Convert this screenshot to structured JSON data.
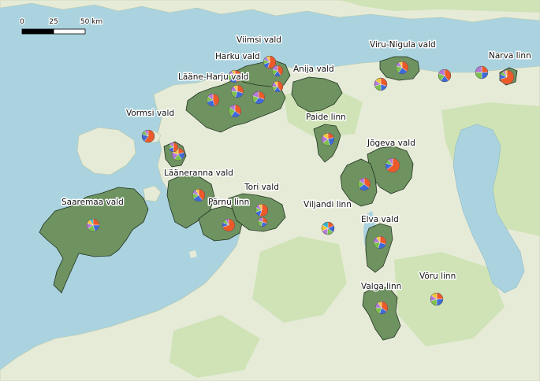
{
  "scale_bar": {
    "labels": [
      "0",
      "25",
      "50 km"
    ]
  },
  "colors": {
    "sea": "#aad3df",
    "land": "#e6ebd8",
    "forest": "#cfe3b6",
    "lake": "#aad3df",
    "region_fill": "#6e9260",
    "region_stroke": "#223322",
    "pie_palette": [
      "#ec5a2a",
      "#3f6ad8",
      "#7cc24a",
      "#b27ad6",
      "#f3c63a",
      "#2fb5c9",
      "#e87fb3",
      "#8a5a3a"
    ]
  },
  "places": [
    {
      "name": "Viimsi vald",
      "pie": [
        55,
        15,
        12,
        10,
        8
      ]
    },
    {
      "name": "Harku vald",
      "pie": [
        45,
        20,
        15,
        12,
        8
      ]
    },
    {
      "name": "Lääne-Harju vald",
      "pie": [
        30,
        25,
        20,
        15,
        10
      ]
    },
    {
      "name": "Anija vald",
      "pie": [
        40,
        20,
        15,
        15,
        10
      ]
    },
    {
      "name": "Viru-Nigula vald",
      "pie": [
        35,
        25,
        20,
        12,
        8
      ]
    },
    {
      "name": "Narva linn",
      "pie": [
        70,
        12,
        8,
        6,
        4
      ]
    },
    {
      "name": "Vormsi vald",
      "pie": [
        60,
        20,
        10,
        10
      ]
    },
    {
      "name": "Paide linn",
      "pie": [
        20,
        25,
        20,
        20,
        15
      ]
    },
    {
      "name": "Jõgeva vald",
      "pie": [
        65,
        15,
        10,
        10
      ]
    },
    {
      "name": "Lääneranna vald",
      "pie": [
        40,
        25,
        15,
        12,
        8
      ]
    },
    {
      "name": "Tori vald",
      "pie": [
        55,
        15,
        12,
        10,
        8
      ]
    },
    {
      "name": "Saaremaa vald",
      "pie": [
        25,
        20,
        20,
        15,
        12,
        8
      ]
    },
    {
      "name": "Pärnu linn",
      "pie": [
        70,
        12,
        10,
        8
      ]
    },
    {
      "name": "Viljandi linn",
      "pie": [
        18,
        18,
        16,
        16,
        16,
        16
      ]
    },
    {
      "name": "Elva vald",
      "pie": [
        30,
        25,
        20,
        15,
        10
      ]
    },
    {
      "name": "Valga linn",
      "pie": [
        35,
        20,
        20,
        15,
        10
      ]
    },
    {
      "name": "Võru linn",
      "pie": [
        25,
        25,
        20,
        15,
        15
      ]
    }
  ],
  "extra_pies": [
    {
      "pie": [
        40,
        20,
        20,
        20
      ]
    },
    {
      "pie": [
        30,
        30,
        20,
        20
      ]
    },
    {
      "pie": [
        45,
        25,
        15,
        15
      ]
    },
    {
      "pie": [
        35,
        25,
        25,
        15
      ]
    },
    {
      "pie": [
        20,
        20,
        20,
        20,
        20
      ]
    },
    {
      "pie": [
        50,
        20,
        15,
        15
      ]
    },
    {
      "pie": [
        30,
        20,
        20,
        15,
        15
      ]
    },
    {
      "pie": [
        40,
        20,
        20,
        20
      ]
    },
    {
      "pie": [
        25,
        25,
        25,
        25
      ]
    },
    {
      "pie": [
        35,
        30,
        20,
        15
      ]
    },
    {
      "pie": [
        30,
        25,
        25,
        20
      ]
    }
  ]
}
